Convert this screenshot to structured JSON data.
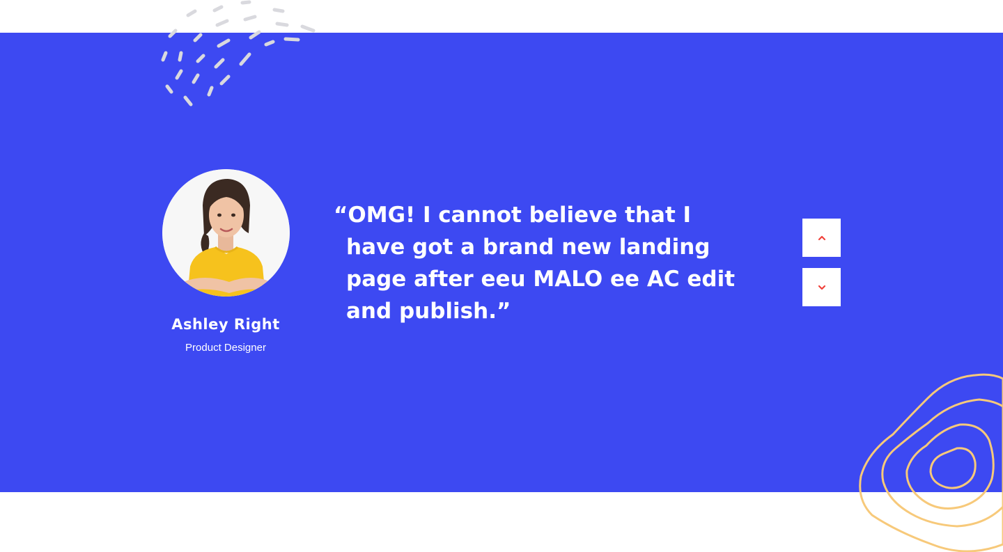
{
  "colors": {
    "band": "#3d49f2",
    "text": "#ffffff",
    "accent": "#f0413a",
    "contour": "#f7c97a",
    "dash": "#d9d9de"
  },
  "testimonial": {
    "quote": "“OMG! I cannot believe that I have got a brand new landing page after   eeu MALO ee AC   edit and publish.”",
    "author_name": "Ashley Right",
    "author_role": "Product Designer",
    "avatar_icon": "person-photo"
  },
  "controls": {
    "prev_icon": "chevron-up-icon",
    "next_icon": "chevron-down-icon"
  },
  "decorations": {
    "top_left": "dash-pattern",
    "bottom_right": "contour-lines"
  }
}
